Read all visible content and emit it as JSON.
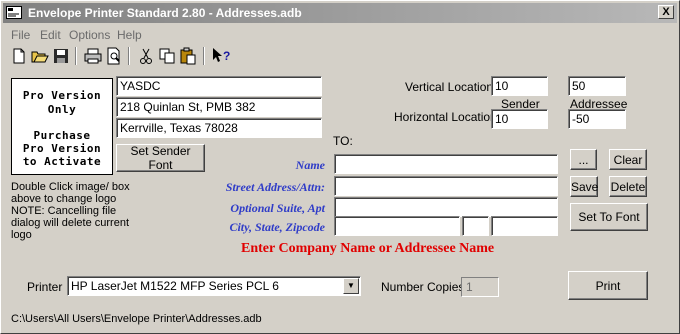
{
  "window": {
    "title": "Envelope Printer Standard 2.80 - Addresses.adb",
    "close_label": "X"
  },
  "menu": [
    "File",
    "Edit",
    "Options",
    "Help"
  ],
  "toolbar_icons": [
    "new-document-icon",
    "open-folder-icon",
    "save-disk-icon",
    "print-icon",
    "print-preview-icon",
    "cut-scissors-icon",
    "copy-icon",
    "paste-icon",
    "context-help-icon"
  ],
  "logo": {
    "line1": "Pro Version",
    "line2": "Only",
    "line3": "Purchase",
    "line4": "Pro Version",
    "line5": "to Activate"
  },
  "sender": {
    "name": "YASDC",
    "street": "218 Quinlan St, PMB 382",
    "city": "Kerrville, Texas 78028",
    "font_button": "Set Sender Font"
  },
  "note": "Double Click image/ box above to change logo NOTE: Cancelling file dialog will delete current logo",
  "locations": {
    "vertical_label": "Vertical Locations",
    "horizontal_label": "Horizontal Locations",
    "sender_col": "Sender",
    "addressee_col": "Addressee",
    "vertical_sender": "10",
    "vertical_addressee": "50",
    "horizontal_sender": "10",
    "horizontal_addressee": "-50"
  },
  "addressee": {
    "to_label": "TO:",
    "name_label": "Name",
    "street_label": "Street Address/Attn:",
    "suite_label": "Optional Suite, Apt",
    "city_label": "City, State, Zipcode",
    "name": "",
    "street": "",
    "suite": "",
    "city": "",
    "state": "",
    "zip": ""
  },
  "buttons": {
    "browse": "...",
    "clear": "Clear",
    "save": "Save",
    "delete": "Delete",
    "set_to_font": "Set To Font",
    "print": "Print"
  },
  "banner": "Enter Company Name or Addressee Name",
  "printer": {
    "label": "Printer",
    "selected": "HP LaserJet M1522 MFP Series PCL 6"
  },
  "copies": {
    "label": "Number Copies",
    "value": "1"
  },
  "status_path": "C:\\Users\\All Users\\Envelope Printer\\Addresses.adb",
  "colors": {
    "label_blue": "#2f3cc8",
    "banner_red": "#e10000",
    "face": "#d4d0c8"
  }
}
